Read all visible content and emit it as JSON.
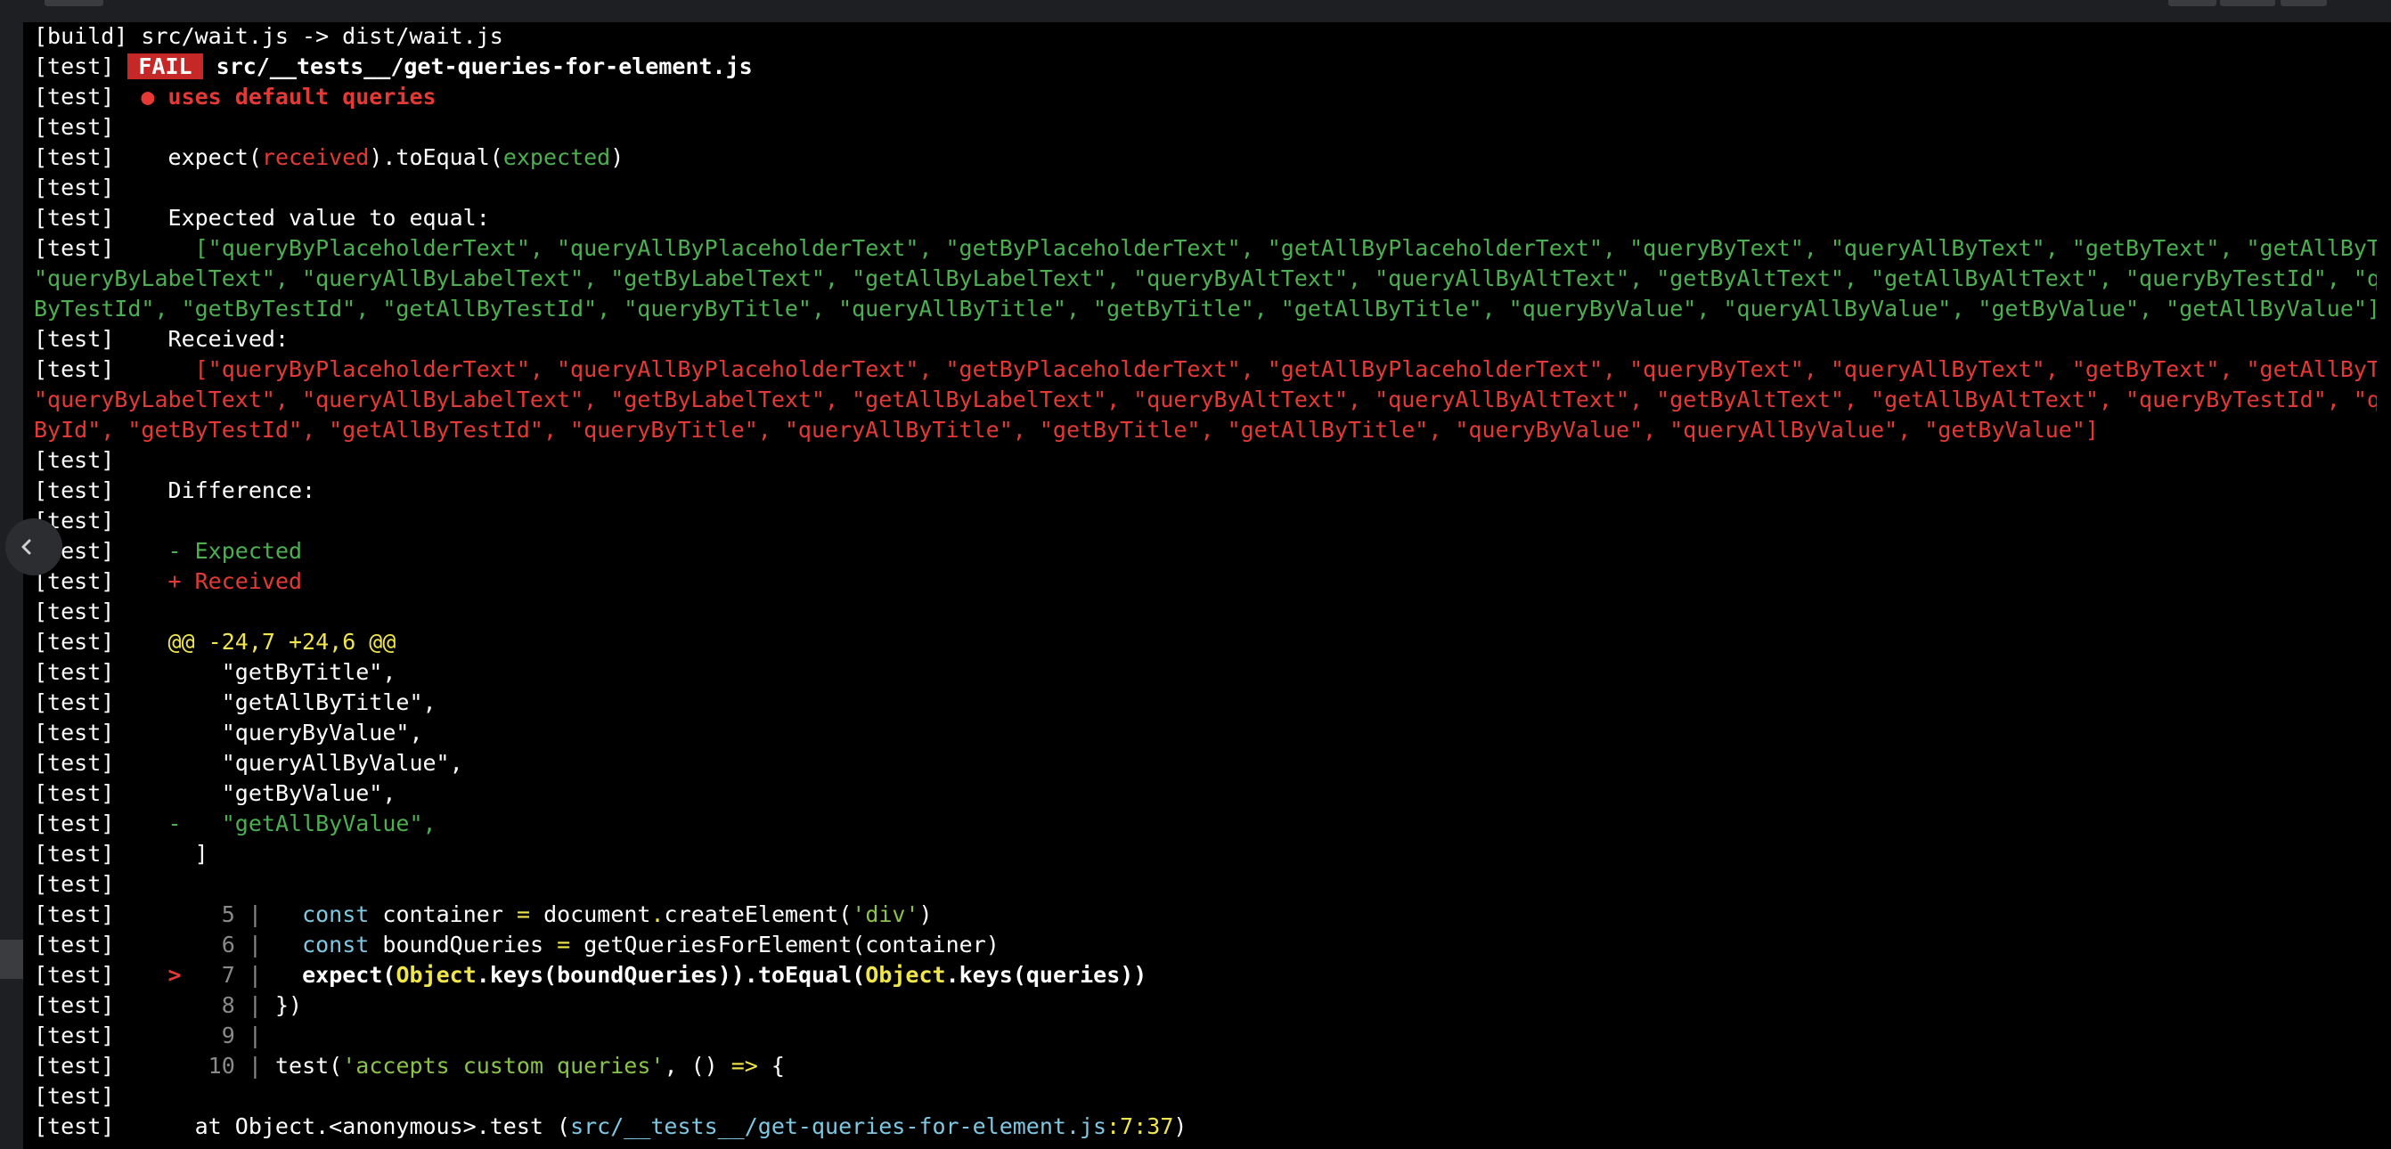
{
  "terminal": {
    "build_line": "[build] src/wait.js -> dist/wait.js",
    "prefix": "[test]",
    "fail_badge": "FAIL",
    "fail_file": "src/__tests__/get-queries-for-element.js",
    "test_name": "● uses default queries",
    "matcher": {
      "expect": "expect(",
      "received": "received",
      "mid": ").toEqual(",
      "expected": "expected",
      "end": ")"
    },
    "expected_header": "Expected value to equal:",
    "expected_value": "[\"queryByPlaceholderText\", \"queryAllByPlaceholderText\", \"getByPlaceholderText\", \"getAllByPlaceholderText\", \"queryByText\", \"queryAllByText\", \"getByText\", \"getAllByText\", \"queryByLabelText\", \"queryAllByLabelText\", \"getByLabelText\", \"getAllByLabelText\", \"queryByAltText\", \"queryAllByAltText\", \"getByAltText\", \"getAllByAltText\", \"queryByTestId\", \"queryAllByTestId\", \"getByTestId\", \"getAllByTestId\", \"queryByTitle\", \"queryAllByTitle\", \"getByTitle\", \"getAllByTitle\", \"queryByValue\", \"queryAllByValue\", \"getByValue\", \"getAllByValue\"]",
    "received_header": "Received:",
    "received_value": "[\"queryByPlaceholderText\", \"queryAllByPlaceholderText\", \"getByPlaceholderText\", \"getAllByPlaceholderText\", \"queryByText\", \"queryAllByText\", \"getByText\", \"getAllByText\", \"queryByLabelText\", \"queryAllByLabelText\", \"getByLabelText\", \"getAllByLabelText\", \"queryByAltText\", \"queryAllByAltText\", \"getByAltText\", \"getAllByAltText\", \"queryByTestId\", \"queryAllByTestId\", \"getByTestId\", \"getAllByTestId\", \"queryByTitle\", \"queryAllByTitle\", \"getByTitle\", \"getAllByTitle\", \"queryByValue\", \"queryAllByValue\", \"getByValue\"]",
    "difference_header": "Difference:",
    "legend_expected": "- Expected",
    "legend_received": "+ Received",
    "hunk_header": "@@ -24,7 +24,6 @@",
    "diff_lines": [
      "\"getByTitle\",",
      "\"getAllByTitle\",",
      "\"queryByValue\",",
      "\"queryAllByValue\",",
      "\"getByValue\","
    ],
    "removed_marker": "-",
    "removed_line": "\"getAllByValue\",",
    "close_bracket": "]",
    "code_frame": {
      "l5_num": "5",
      "l6_num": "6",
      "l7_num": "7",
      "l8_num": "8",
      "l9_num": "9",
      "l10_num": "10",
      "gutter": "|",
      "pointer": ">",
      "kw_const": "const",
      "container": "container",
      "eq": "=",
      "document": "document",
      "dot": ".",
      "createElement": "createElement(",
      "div_str": "'div'",
      "close_paren": ")",
      "boundQueries": "boundQueries",
      "getQueries": "getQueriesForElement(container)",
      "l7_a": "expect(",
      "object_kw": "Object",
      "l7_b": ".keys(boundQueries)).toEqual(",
      "l7_c": ".keys(queries))",
      "l8": "})",
      "l10_a": "test(",
      "l10_str": "'accepts custom queries'",
      "l10_b": ", () ",
      "l10_arrow": "=>",
      "l10_c": " {"
    },
    "stack": {
      "at": "at Object.<anonymous>.test (",
      "path": "src/__tests__/get-queries-for-element.js",
      "pos": ":7:37",
      "end": ")"
    }
  },
  "colors": {
    "fail_bg": "#c62828",
    "error_red": "#e53935",
    "expected_green": "#4caf50",
    "highlight_yellow": "#f0e64a"
  },
  "icons": {
    "sidebar_toggle": "chevron-left-icon"
  }
}
